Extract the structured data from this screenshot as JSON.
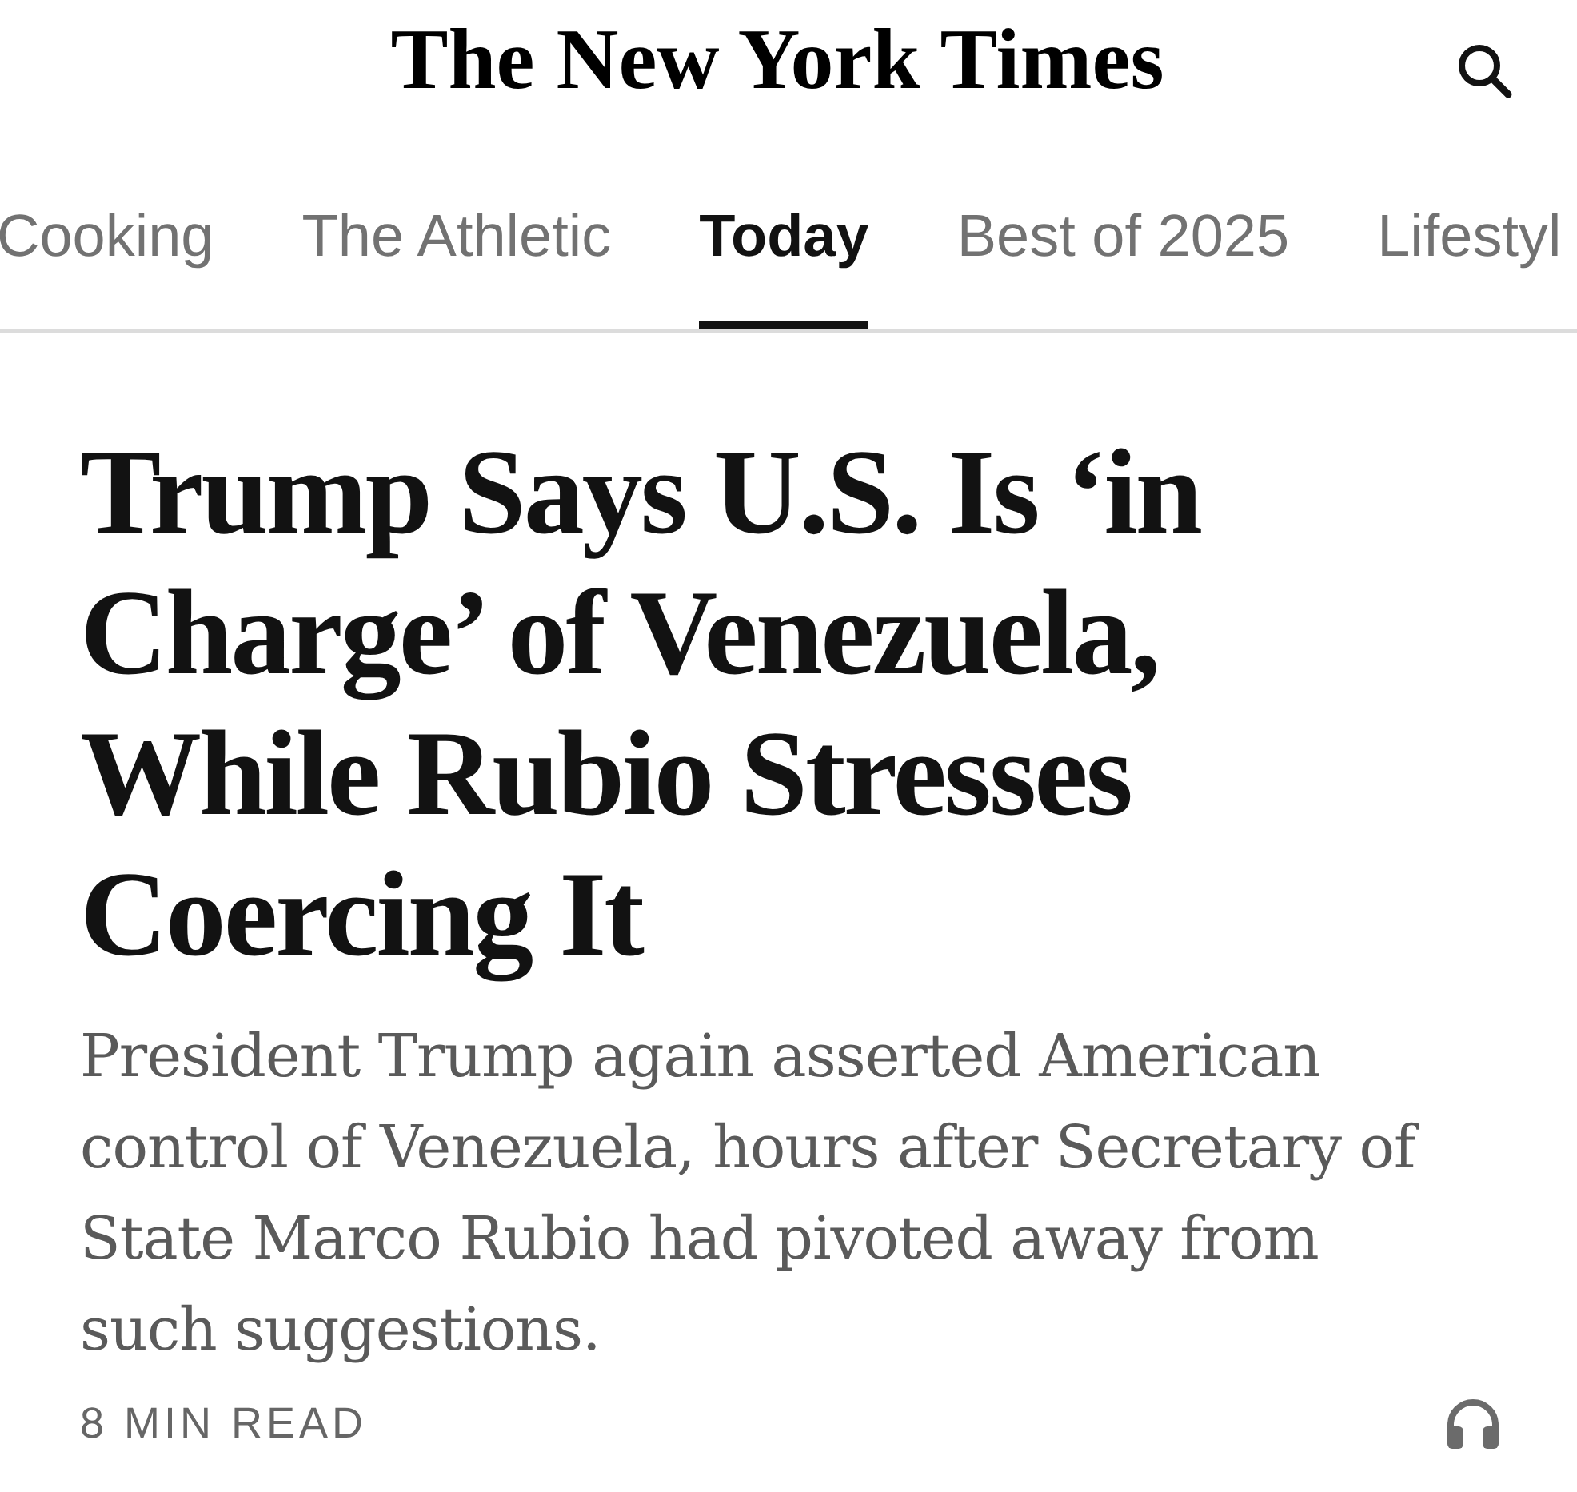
{
  "masthead": {
    "logo": "The New York Times"
  },
  "nav": {
    "tabs": [
      {
        "label": "Cooking",
        "selected": false
      },
      {
        "label": "The Athletic",
        "selected": false
      },
      {
        "label": "Today",
        "selected": true
      },
      {
        "label": "Best of 2025",
        "selected": false
      },
      {
        "label": "Lifestyl",
        "selected": false
      }
    ]
  },
  "article": {
    "headline": "Trump Says U.S. Is ‘in Charge’ of Venezuela, While Rubio Stresses Coercing It",
    "summary": "President Trump again asserted American control of Venezuela, hours after Secretary of State Marco Rubio had pivoted away from such suggestions.",
    "read_time": "8 MIN READ"
  }
}
